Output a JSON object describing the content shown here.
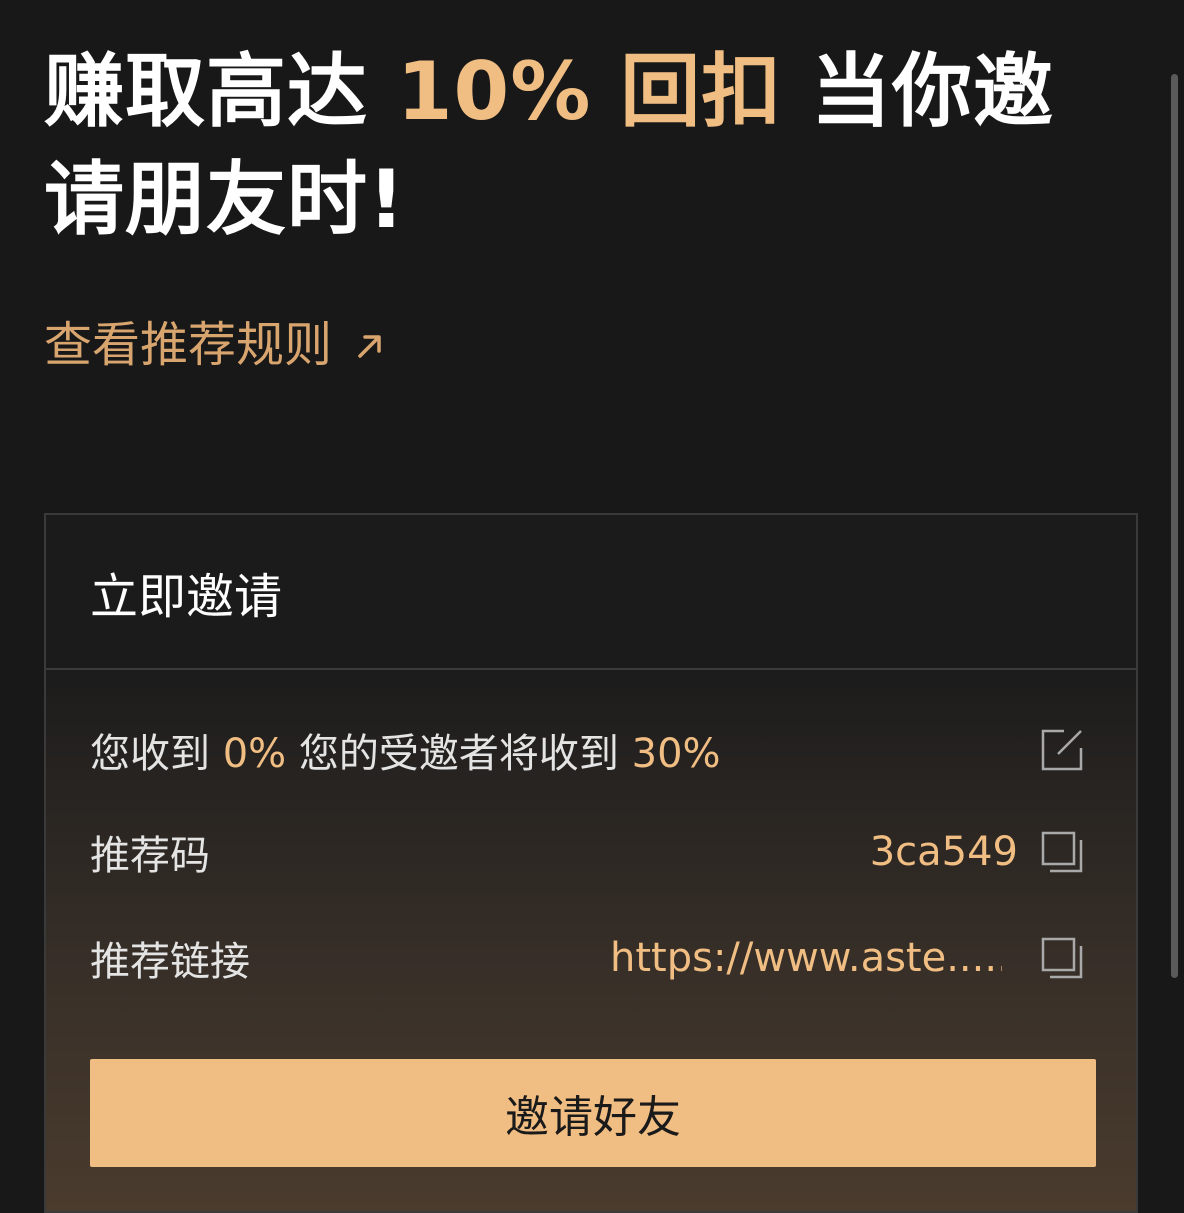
{
  "hero": {
    "title_part1": "赚取高达 ",
    "title_accent": "10% 回扣",
    "title_part2": " 当你邀请朋友时!"
  },
  "rules_link": {
    "label": "查看推荐规则",
    "icon": "arrow-up-right-icon"
  },
  "invite_card": {
    "title": "立即邀请",
    "rebate": {
      "you_receive_label": "您收到",
      "you_receive_value": "0%",
      "invitee_label": "您的受邀者将收到",
      "invitee_value": "30%",
      "icon": "edit-icon"
    },
    "referral_code": {
      "label": "推荐码",
      "value": "3ca549",
      "icon": "copy-icon"
    },
    "referral_link": {
      "label": "推荐链接",
      "value": "https://www.aste......",
      "icon": "copy-icon"
    },
    "button_label": "邀请好友"
  },
  "colors": {
    "background": "#181818",
    "accent": "#f0bd83",
    "link": "#d9a56f",
    "button_text": "#1a1a1a"
  }
}
